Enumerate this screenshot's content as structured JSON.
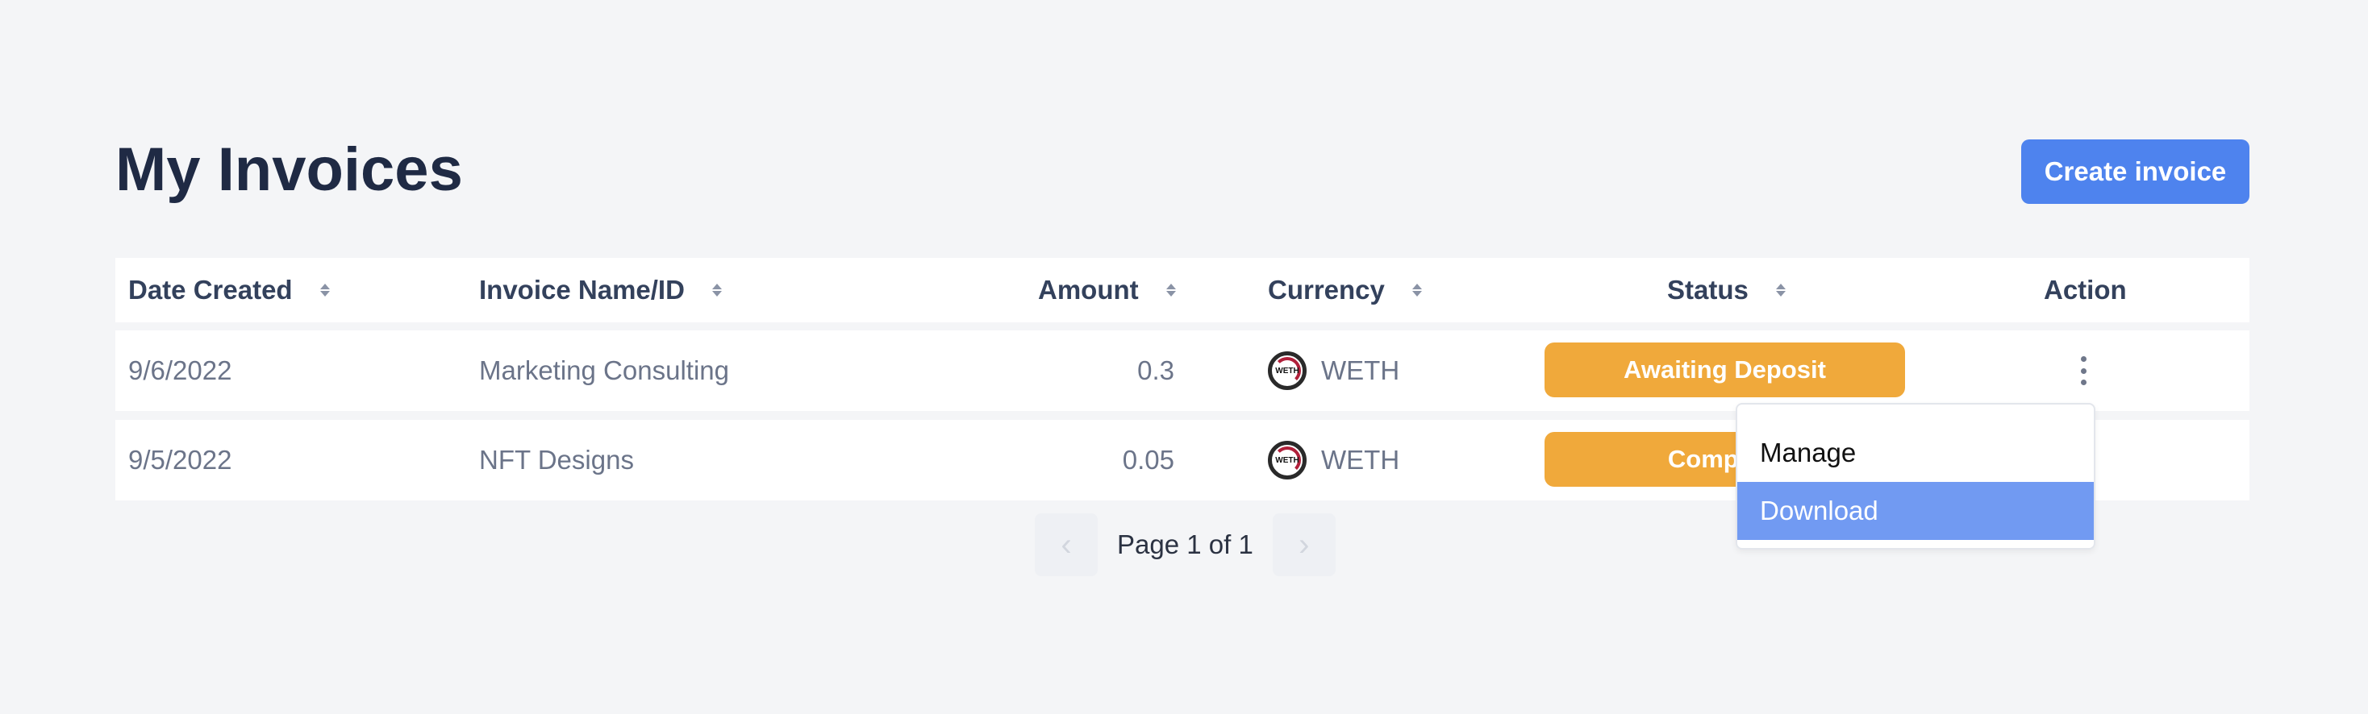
{
  "page": {
    "title": "My Invoices",
    "create_button": "Create invoice"
  },
  "table": {
    "columns": [
      {
        "label": "Date Created",
        "sortable": true
      },
      {
        "label": "Invoice Name/ID",
        "sortable": true
      },
      {
        "label": "Amount",
        "sortable": true
      },
      {
        "label": "Currency",
        "sortable": true
      },
      {
        "label": "Status",
        "sortable": true
      },
      {
        "label": "Action",
        "sortable": false
      }
    ],
    "rows": [
      {
        "date": "9/6/2022",
        "name": "Marketing Consulting",
        "amount": "0.3",
        "currency": "WETH",
        "currency_icon": "weth-icon",
        "status": "Awaiting Deposit"
      },
      {
        "date": "9/5/2022",
        "name": "NFT Designs",
        "amount": "0.05",
        "currency": "WETH",
        "currency_icon": "weth-icon",
        "status": "Complete"
      }
    ]
  },
  "action_menu": {
    "items": [
      "Manage",
      "Download"
    ],
    "highlighted": "Download"
  },
  "pagination": {
    "text": "Page 1 of 1",
    "prev_icon": "chevron-left-icon",
    "next_icon": "chevron-right-icon"
  },
  "colors": {
    "primary": "#4e83ee",
    "status": "#f0a93b",
    "menu_highlight": "#719af2"
  }
}
